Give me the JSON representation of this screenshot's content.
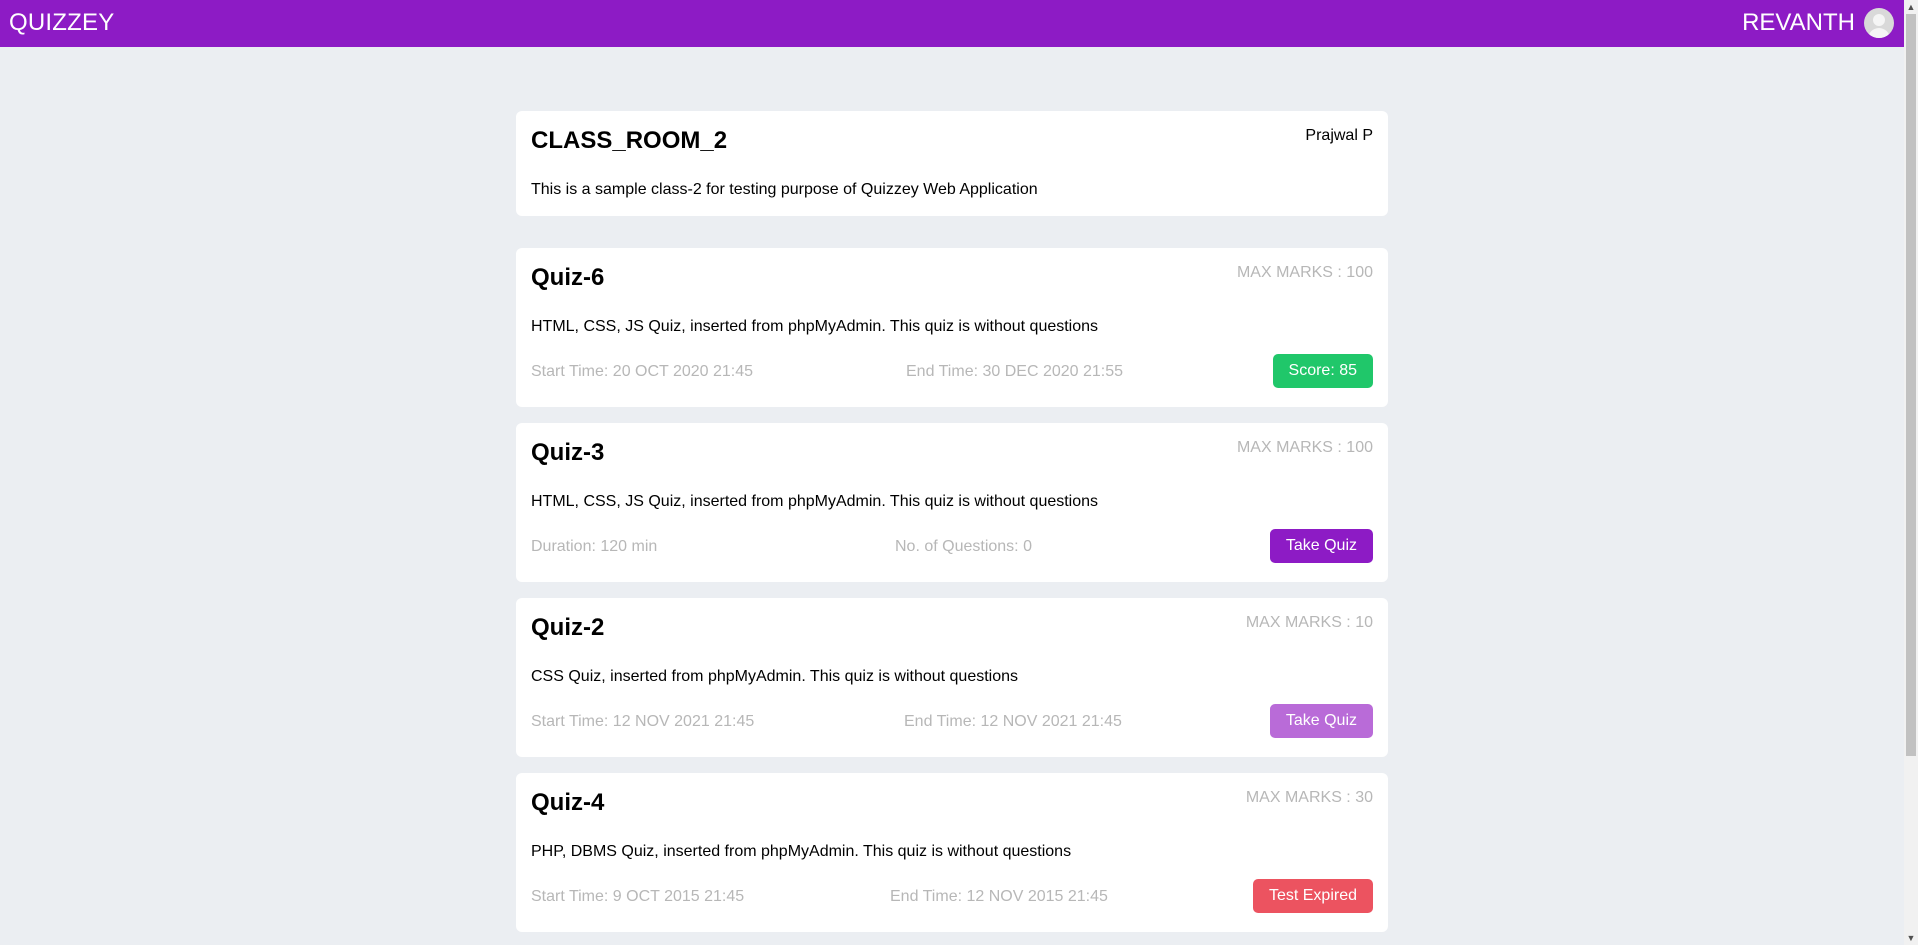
{
  "header": {
    "brand": "QUIZZEY",
    "username": "REVANTH"
  },
  "classroom": {
    "name": "CLASS_ROOM_2",
    "owner": "Prajwal P",
    "description": "This is a sample class-2 for testing purpose of Quizzey Web Application"
  },
  "quizzes": [
    {
      "title": "Quiz-6",
      "max_marks": "MAX MARKS : 100",
      "description": "HTML, CSS, JS Quiz, inserted from phpMyAdmin. This quiz is without questions",
      "left_info": "Start Time: 20 OCT 2020 21:45",
      "mid_info": "End Time: 30 DEC 2020 21:55",
      "action_label": "Score: 85",
      "action_color": "#20c76a"
    },
    {
      "title": "Quiz-3",
      "max_marks": "MAX MARKS : 100",
      "description": "HTML, CSS, JS Quiz, inserted from phpMyAdmin. This quiz is without questions",
      "left_info": "Duration: 120 min",
      "mid_info": "No. of Questions: 0",
      "action_label": "Take Quiz",
      "action_color": "#8d1bc5"
    },
    {
      "title": "Quiz-2",
      "max_marks": "MAX MARKS : 10",
      "description": "CSS Quiz, inserted from phpMyAdmin. This quiz is without questions",
      "left_info": "Start Time: 12 NOV 2021 21:45",
      "mid_info": "End Time: 12 NOV 2021 21:45",
      "action_label": "Take Quiz",
      "action_color": "#b96bd8"
    },
    {
      "title": "Quiz-4",
      "max_marks": "MAX MARKS : 30",
      "description": "PHP, DBMS Quiz, inserted from phpMyAdmin. This quiz is without questions",
      "left_info": "Start Time: 9 OCT 2015 21:45",
      "mid_info": "End Time: 12 NOV 2015 21:45",
      "action_label": "Test Expired",
      "action_color": "#ec5360"
    }
  ]
}
